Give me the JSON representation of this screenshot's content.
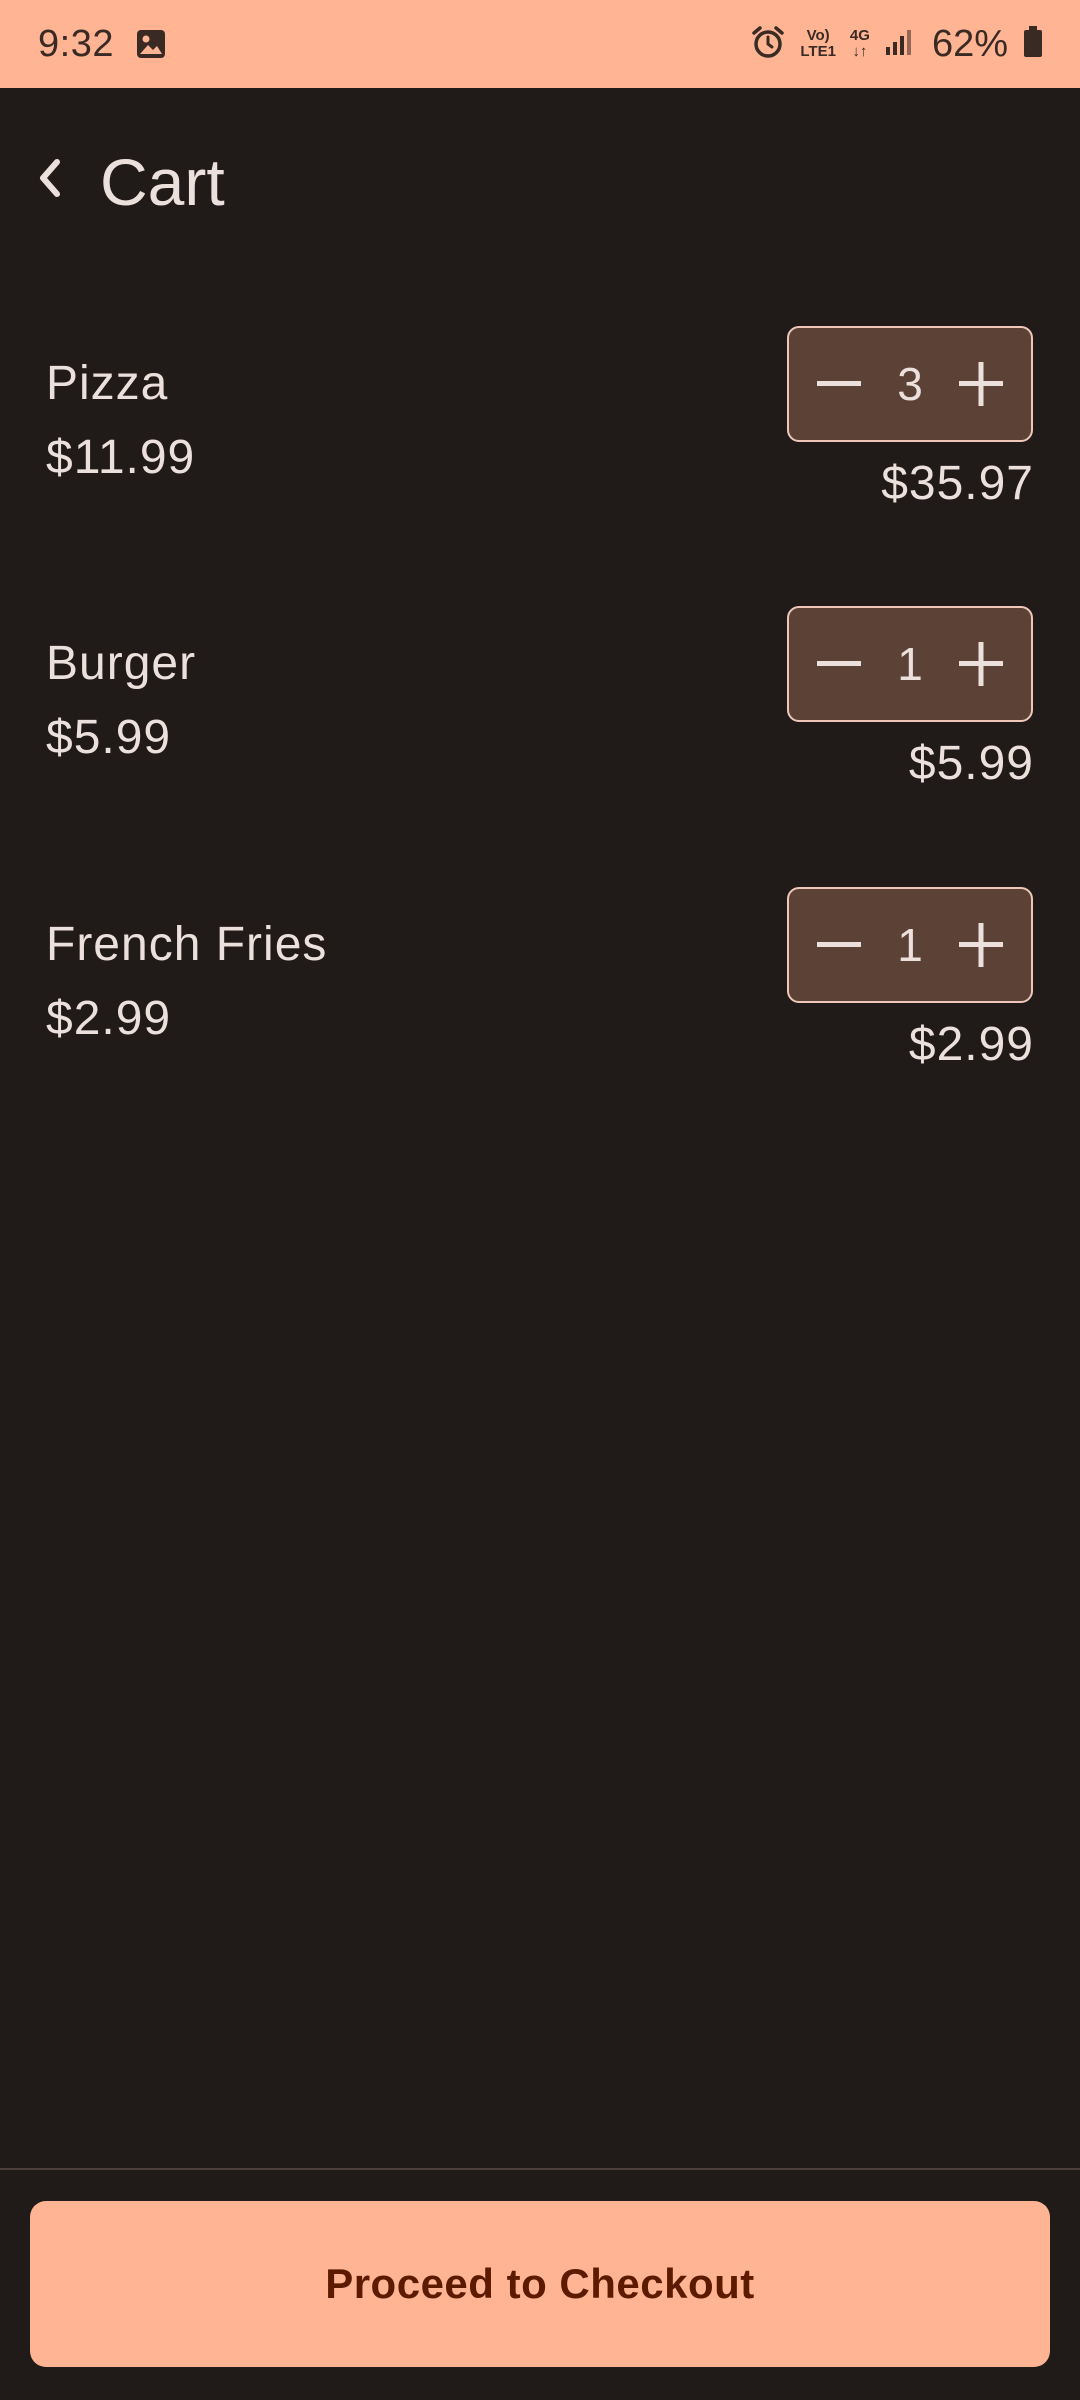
{
  "status_bar": {
    "time": "9:32",
    "network_top": "Vo)",
    "network_bottom": "LTE1",
    "data_type": "4G",
    "battery": "62%",
    "icons": [
      "gallery-icon",
      "alarm-icon",
      "signal-icon",
      "battery-icon"
    ]
  },
  "app_bar": {
    "title": "Cart",
    "back_icon": "chevron-left-icon"
  },
  "cart": {
    "items": [
      {
        "name": "Pizza",
        "price": "$11.99",
        "quantity": "3",
        "total": "$35.97"
      },
      {
        "name": "Burger",
        "price": "$5.99",
        "quantity": "1",
        "total": "$5.99"
      },
      {
        "name": "French Fries",
        "price": "$2.99",
        "quantity": "1",
        "total": "$2.99"
      }
    ]
  },
  "checkout": {
    "label": "Proceed to Checkout"
  },
  "colors": {
    "background": "#201a18",
    "accent": "#ffb593",
    "stepper_fill": "#5c4137",
    "stepper_border": "#eec7b8",
    "text": "#ece0dc",
    "button_text": "#5c1a00"
  }
}
